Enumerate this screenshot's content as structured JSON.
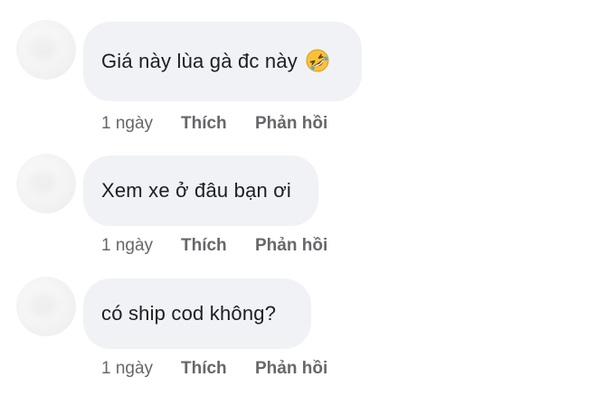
{
  "comments": [
    {
      "text": "Giá này lùa gà đc này",
      "emoji": "rolling-on-floor-laughing-emoji",
      "time": "1 ngày",
      "like_label": "Thích",
      "reply_label": "Phản hồi"
    },
    {
      "text": "Xem xe ở đâu bạn ơi",
      "time": "1 ngày",
      "like_label": "Thích",
      "reply_label": "Phản hồi"
    },
    {
      "text": "có ship cod không?",
      "time": "1 ngày",
      "like_label": "Thích",
      "reply_label": "Phản hồi"
    }
  ],
  "colors": {
    "bubble_bg": "#f0f2f5",
    "text": "#1c1e21",
    "meta": "#65676b"
  }
}
